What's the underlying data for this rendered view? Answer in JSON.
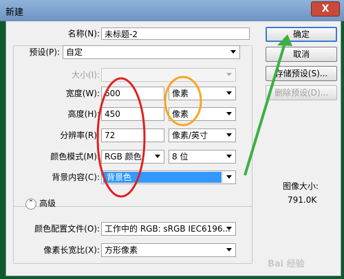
{
  "window": {
    "title": "新建",
    "close_label": "X"
  },
  "form": {
    "name_label": "名称(N):",
    "name_value": "未标题-2",
    "preset_label": "预设(P):",
    "preset_value": "自定",
    "size_label": "大小(I):",
    "size_value": "",
    "width_label": "宽度(W):",
    "width_value": "600",
    "width_unit": "像素",
    "height_label": "高度(H):",
    "height_value": "450",
    "height_unit": "像素",
    "resolution_label": "分辨率(R):",
    "resolution_value": "72",
    "resolution_unit": "像素/英寸",
    "color_mode_label": "颜色模式(M):",
    "color_mode_value": "RGB 颜色",
    "bit_depth_value": "8 位",
    "background_label": "背景内容(C):",
    "background_value": "背景色",
    "advanced_label": "高级",
    "advanced_icon": "chevron-up-icon",
    "color_profile_label": "颜色配置文件(O):",
    "color_profile_value": "工作中的 RGB: sRGB IEC6196...",
    "pixel_aspect_label": "像素长宽比(X):",
    "pixel_aspect_value": "方形像素"
  },
  "buttons": {
    "ok": "确定",
    "cancel": "取消",
    "save_preset": "存储预设(S)...",
    "delete_preset": "删除预设(D)..."
  },
  "image_size": {
    "label": "图像大小:",
    "value": "791.0K"
  },
  "watermark": "Bai 经验",
  "colors": {
    "highlight": "#3399ff",
    "annotation_red": "#e02020",
    "annotation_orange": "#f5a623",
    "annotation_green": "#3cb043"
  }
}
